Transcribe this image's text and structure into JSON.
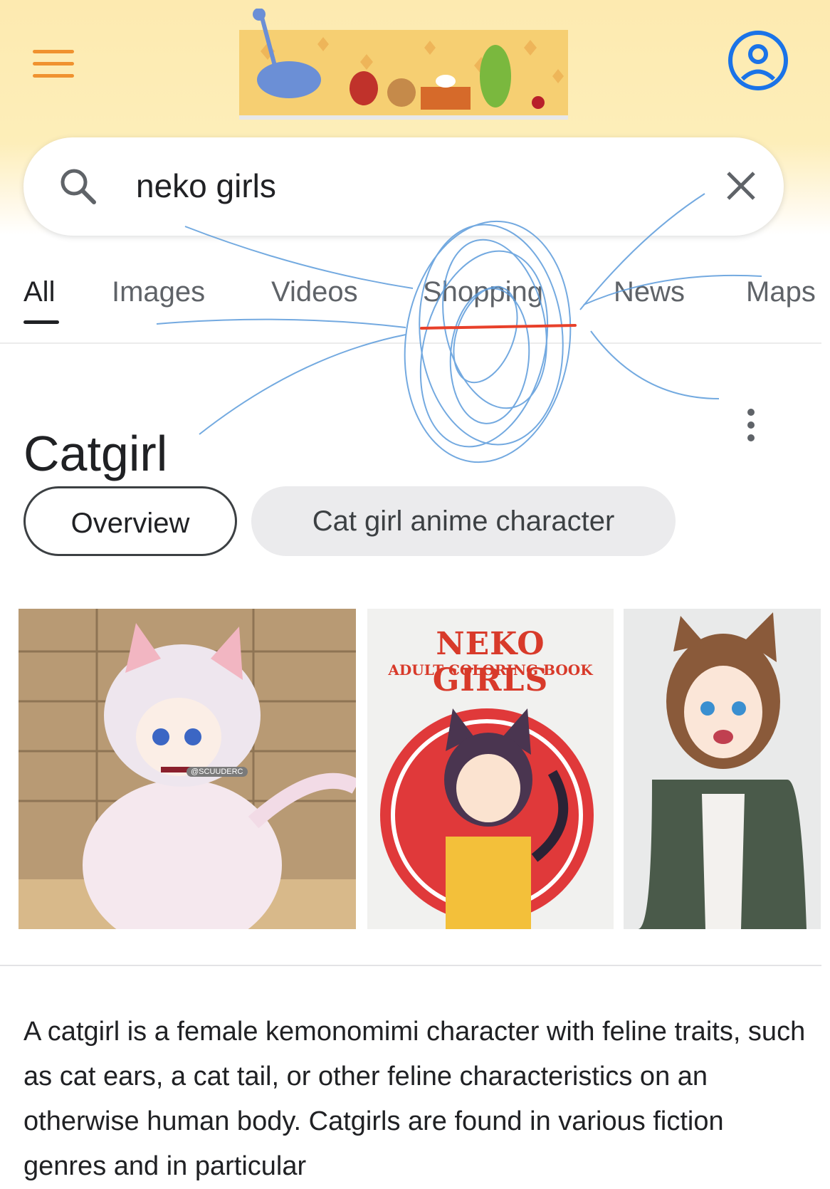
{
  "search": {
    "query": "neko girls"
  },
  "tabs": [
    {
      "label": "All",
      "active": true
    },
    {
      "label": "Images"
    },
    {
      "label": "Videos"
    },
    {
      "label": "Shopping"
    },
    {
      "label": "News"
    },
    {
      "label": "Maps"
    }
  ],
  "knowledge_panel": {
    "title": "Catgirl",
    "chips": [
      {
        "label": "Overview",
        "selected": true
      },
      {
        "label": "Cat girl anime character",
        "selected": false
      }
    ],
    "images": [
      {
        "watermark": "@SCUUDERC"
      },
      {
        "cover_title": "NEKO GIRLS",
        "cover_subtitle": "ADULT COLORING BOOK"
      },
      {}
    ],
    "description": "A catgirl is a female kemonomimi character with feline traits, such as cat ears, a cat tail, or other feline characteristics on an otherwise human body. Catgirls are found in various fiction genres and in particular"
  },
  "icons": [
    "menu-icon",
    "google-doodle",
    "account-icon",
    "search-icon",
    "close-icon",
    "more-vert-icon"
  ],
  "colors": {
    "header_bg": "#fdeab0",
    "menu_icon": "#f0922f",
    "account_icon": "#1a73e8",
    "scribble": "#5b9bdb",
    "annotation_underline": "#e8402a"
  }
}
